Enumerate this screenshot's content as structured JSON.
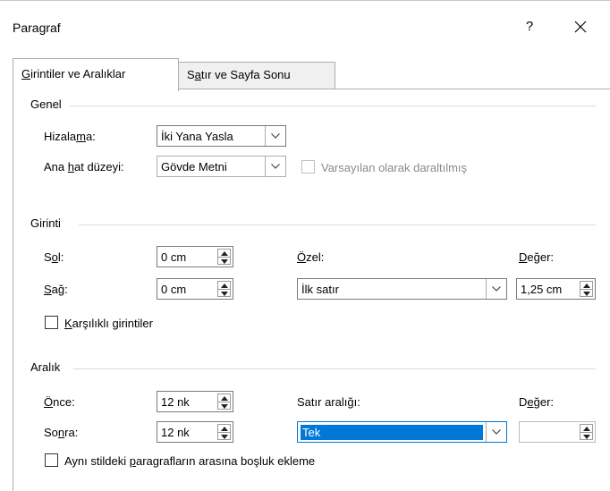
{
  "window": {
    "title": "Paragraf",
    "help_label": "?"
  },
  "tabs": [
    {
      "label_pre": "",
      "label_u": "G",
      "label_post": "irintiler ve Aralıklar",
      "active": true
    },
    {
      "label_pre": "S",
      "label_u": "a",
      "label_post": "tır ve Sayfa Sonu",
      "active": false
    }
  ],
  "general": {
    "title": "Genel",
    "alignment": {
      "label_pre": "Hizala",
      "label_u": "m",
      "label_post": "a:",
      "value": "İki Yana Yasla"
    },
    "outline": {
      "label_pre": "Ana ",
      "label_u": "h",
      "label_post": "at düzeyi:",
      "value": "Gövde Metni"
    },
    "collapsed_default": {
      "label": "Varsayılan olarak daraltılmış",
      "checked": false,
      "enabled": false
    }
  },
  "indent": {
    "title": "Girinti",
    "left": {
      "label_pre": "S",
      "label_u": "o",
      "label_post": "l:",
      "value": "0 cm"
    },
    "right": {
      "label_pre": "",
      "label_u": "S",
      "label_post": "ağ:",
      "value": "0 cm"
    },
    "special": {
      "label_pre": "",
      "label_u": "Ö",
      "label_post": "zel:",
      "value": "İlk satır"
    },
    "by": {
      "label_pre": "",
      "label_u": "D",
      "label_post": "eğer:",
      "value": "1,25 cm"
    },
    "mirror": {
      "label_pre": "",
      "label_u": "K",
      "label_post": "arşılıklı girintiler",
      "checked": false
    }
  },
  "spacing": {
    "title": "Aralık",
    "before": {
      "label_pre": "",
      "label_u": "Ö",
      "label_post": "nce:",
      "value": "12 nk"
    },
    "after": {
      "label_pre": "So",
      "label_u": "n",
      "label_post": "ra:",
      "value": "12 nk"
    },
    "line_spacing": {
      "label_pre": "Satır aralı",
      "label_u": "ğ",
      "label_post": "ı:",
      "value": "Tek"
    },
    "at": {
      "label_pre": "D",
      "label_u": "e",
      "label_post": "ğer:",
      "value": ""
    },
    "no_space": {
      "label_pre": "Aynı stildeki ",
      "label_u": "p",
      "label_post": "aragrafların arasına boşluk ekleme",
      "checked": false
    }
  }
}
